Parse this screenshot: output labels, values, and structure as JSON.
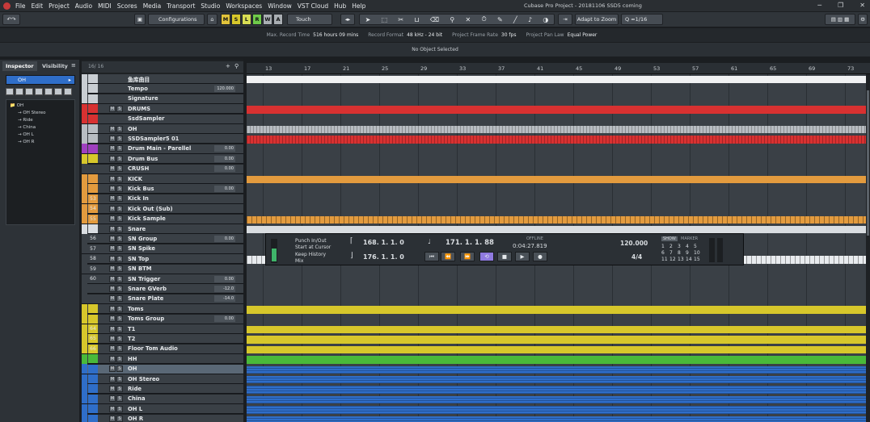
{
  "menu": {
    "items": [
      "File",
      "Edit",
      "Project",
      "Audio",
      "MIDI",
      "Scores",
      "Media",
      "Transport",
      "Studio",
      "Workspaces",
      "Window",
      "VST Cloud",
      "Hub",
      "Help"
    ],
    "window_title": "Cubase Pro Project - 20181106 SSD5 coming"
  },
  "toolbar": {
    "configurations": "Configurations",
    "mode_keys": [
      "M",
      "S",
      "L",
      "R",
      "W",
      "A"
    ],
    "automation_mode": "Touch",
    "zoom_mode": "Adapt to Zoom",
    "quantize": "1/16"
  },
  "infobar": {
    "items": [
      {
        "label": "Max. Record Time",
        "value": "516 hours 09 mins"
      },
      {
        "label": "Record Format",
        "value": "48 kHz - 24 bit"
      },
      {
        "label": "Project Frame Rate",
        "value": "30 fps"
      },
      {
        "label": "Project Pan Law",
        "value": "Equal Power"
      }
    ]
  },
  "selection": "No Object Selected",
  "inspector": {
    "tabs": [
      "Inspector",
      "Visibility"
    ],
    "track_name": "OH",
    "tree": [
      "OH",
      "OH Stereo",
      "Ride",
      "China",
      "OH L",
      "OH R"
    ]
  },
  "tracklist": {
    "header": "16/ 16",
    "tracks": [
      {
        "name": "鱼库曲目",
        "color": "#c9ced3",
        "value": "",
        "icon": "",
        "ms": false
      },
      {
        "name": "Tempo",
        "color": "#c9ced3",
        "value": "120.000",
        "icon": "",
        "ms": false
      },
      {
        "name": "Signature",
        "color": "#c9ced3",
        "value": "",
        "icon": "",
        "ms": false
      },
      {
        "name": "DRUMS",
        "color": "#d83131",
        "value": "",
        "icon": "",
        "ms": true
      },
      {
        "name": "SsdSampler",
        "color": "#d83131",
        "value": "",
        "icon": "",
        "ms": false
      },
      {
        "name": "OH",
        "color": "#b8bdc2",
        "value": "",
        "icon": "",
        "ms": true
      },
      {
        "name": "SSDSampler5 01",
        "color": "#b8bdc2",
        "value": "",
        "icon": "",
        "ms": true
      },
      {
        "name": "Drum Main - Parellel",
        "color": "#9f3fbf",
        "value": "0.00",
        "icon": "",
        "ms": true
      },
      {
        "name": "Drum Bus",
        "color": "#d7c72b",
        "value": "0.00",
        "icon": "",
        "ms": true
      },
      {
        "name": "CRUSH",
        "color": "#3a4046",
        "value": "0.00",
        "icon": "",
        "ms": true
      },
      {
        "name": "KICK",
        "color": "#e39b3e",
        "value": "",
        "icon": "",
        "ms": true
      },
      {
        "name": "Kick Bus",
        "color": "#e39b3e",
        "value": "0.00",
        "icon": "",
        "ms": true
      },
      {
        "name": "Kick In",
        "color": "#e39b3e",
        "value": "",
        "icon": "53",
        "ms": true
      },
      {
        "name": "Kick Out (Sub)",
        "color": "#e39b3e",
        "value": "",
        "icon": "54",
        "ms": true
      },
      {
        "name": "Kick Sample",
        "color": "#e39b3e",
        "value": "",
        "icon": "55",
        "ms": true
      },
      {
        "name": "Snare",
        "color": "#d9dde1",
        "value": "",
        "icon": "",
        "ms": true
      },
      {
        "name": "SN Group",
        "color": "#3a4046",
        "value": "0.00",
        "icon": "56",
        "ms": true
      },
      {
        "name": "SN Spike",
        "color": "#3a4046",
        "value": "",
        "icon": "57",
        "ms": true
      },
      {
        "name": "SN Top",
        "color": "#3a4046",
        "value": "",
        "icon": "58",
        "ms": true
      },
      {
        "name": "SN BTM",
        "color": "#3a4046",
        "value": "",
        "icon": "59",
        "ms": true
      },
      {
        "name": "SN Trigger",
        "color": "#3a4046",
        "value": "0.00",
        "icon": "60",
        "ms": true
      },
      {
        "name": "Snare GVerb",
        "color": "#3a4046",
        "value": "-12.0",
        "icon": "",
        "ms": true
      },
      {
        "name": "Snare Plate",
        "color": "#3a4046",
        "value": "-14.0",
        "icon": "",
        "ms": true
      },
      {
        "name": "Toms",
        "color": "#d7c72b",
        "value": "",
        "icon": "",
        "ms": true
      },
      {
        "name": "Toms Group",
        "color": "#d7c72b",
        "value": "0.00",
        "icon": "",
        "ms": true
      },
      {
        "name": "T1",
        "color": "#d7c72b",
        "value": "",
        "icon": "64",
        "ms": true
      },
      {
        "name": "T2",
        "color": "#d7c72b",
        "value": "",
        "icon": "65",
        "ms": true
      },
      {
        "name": "Floor Tom Audio",
        "color": "#d7c72b",
        "value": "",
        "icon": "66",
        "ms": true
      },
      {
        "name": "HH",
        "color": "#49b93a",
        "value": "",
        "icon": "",
        "ms": true
      },
      {
        "name": "OH",
        "color": "#2f6ec9",
        "value": "",
        "icon": "",
        "ms": true
      },
      {
        "name": "OH Stereo",
        "color": "#2f6ec9",
        "value": "",
        "icon": "",
        "ms": true
      },
      {
        "name": "Ride",
        "color": "#2f6ec9",
        "value": "",
        "icon": "",
        "ms": true
      },
      {
        "name": "China",
        "color": "#2f6ec9",
        "value": "",
        "icon": "",
        "ms": true
      },
      {
        "name": "OH L",
        "color": "#2f6ec9",
        "value": "",
        "icon": "",
        "ms": true
      },
      {
        "name": "OH R",
        "color": "#2f6ec9",
        "value": "",
        "icon": "",
        "ms": true
      }
    ]
  },
  "ruler": {
    "bars": [
      "13",
      "17",
      "21",
      "25",
      "29",
      "33",
      "37",
      "41",
      "45",
      "49",
      "53",
      "57",
      "61",
      "65",
      "69",
      "73"
    ]
  },
  "transport": {
    "punch_labels": [
      "Punch In/Out",
      "Start at Cursor",
      "Keep History",
      "Mix"
    ],
    "left_locator": "168. 1. 1.  0",
    "right_locator": "176. 1. 1.  0",
    "position": "171. 1. 1. 88",
    "time": "0:04:27.819",
    "status": "OFFLINE",
    "tempo": "120.000",
    "signature": "4/4",
    "show_label": "SHOW",
    "marker_label": "MARKER",
    "markers": [
      "1",
      "2",
      "3",
      "4",
      "5",
      "6",
      "7",
      "8",
      "9",
      "10",
      "11",
      "12",
      "13",
      "14",
      "15"
    ]
  },
  "colors": {
    "drums": "#d83131",
    "kick": "#e39b3e",
    "snare": "#d9dde1",
    "toms": "#d7c72b",
    "hh": "#49b93a",
    "oh": "#2f6ec9",
    "purple": "#9f3fbf"
  }
}
